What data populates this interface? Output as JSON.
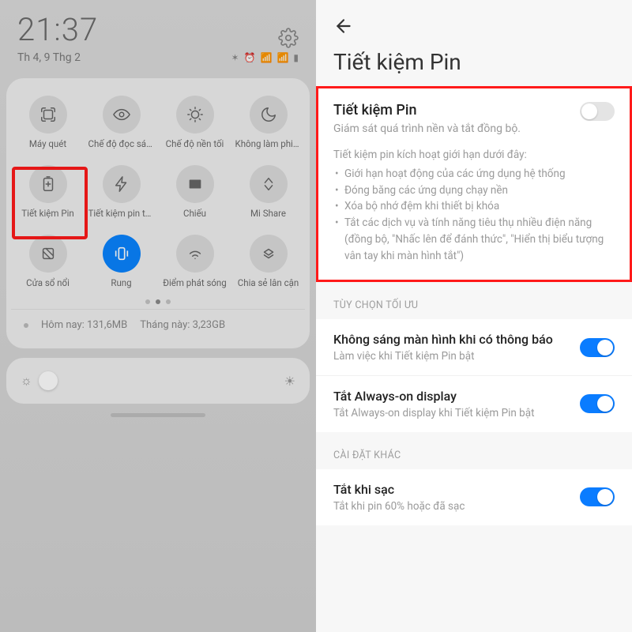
{
  "left": {
    "clock": "21:37",
    "date": "Th 4, 9 Thg 2",
    "qs": [
      {
        "label": "Máy quét",
        "icon": "scan"
      },
      {
        "label": "Chế độ đọc sách",
        "icon": "eye"
      },
      {
        "label": "Chế độ nền tối",
        "icon": "dark"
      },
      {
        "label": "Không làm phiền",
        "icon": "moon"
      },
      {
        "label": "Tiết kiệm Pin",
        "icon": "battery"
      },
      {
        "label": "Tiết kiệm pin tối đa",
        "icon": "bolt"
      },
      {
        "label": "Chiếu",
        "icon": "cast"
      },
      {
        "label": "Mi Share",
        "icon": "share"
      },
      {
        "label": "Cửa sổ nổi",
        "icon": "float"
      },
      {
        "label": "Rung",
        "icon": "vibrate",
        "on": true
      },
      {
        "label": "Điểm phát sóng",
        "icon": "wifi"
      },
      {
        "label": "Chia sẻ lân cận",
        "icon": "nearby"
      }
    ],
    "data_today_label": "Hôm nay:",
    "data_today_value": "131,6MB",
    "data_month_label": "Tháng này:",
    "data_month_value": "3,23GB"
  },
  "right": {
    "title": "Tiết kiệm Pin",
    "main": {
      "title": "Tiết kiệm Pin",
      "sub": "Giám sát quá trình nền và tắt đồng bộ.",
      "info": "Tiết kiệm pin kích hoạt giới hạn dưới đây:",
      "bullets": [
        "Giới hạn hoạt động của các ứng dụng hệ thống",
        "Đóng băng các ứng dụng chạy nền",
        "Xóa bộ nhớ đệm khi thiết bị khóa",
        "Tắt các dịch vụ và tính năng tiêu thụ nhiều điện năng (đồng bộ, \"Nhấc lên để đánh thức\", \"Hiển thị biểu tượng vân tay khi màn hình tắt\")"
      ]
    },
    "group1_label": "TÙY CHỌN TỐI ƯU",
    "opts1": [
      {
        "title": "Không sáng màn hình khi có thông báo",
        "sub": "Làm việc khi Tiết kiệm Pin bật",
        "on": true
      },
      {
        "title": "Tắt Always-on display",
        "sub": "Tắt Always-on display khi Tiết kiệm Pin bật",
        "on": true
      }
    ],
    "group2_label": "CÀI ĐẶT KHÁC",
    "opts2": [
      {
        "title": "Tắt khi sạc",
        "sub": "Tắt khi pin 60% hoặc đã sạc",
        "on": true
      }
    ]
  }
}
